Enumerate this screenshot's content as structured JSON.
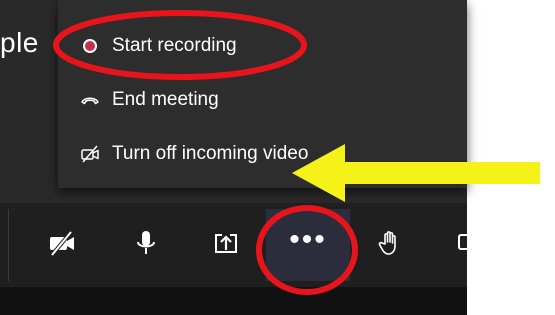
{
  "meeting": {
    "title_partial": "ple"
  },
  "menu": {
    "items": [
      {
        "label": "Start recording",
        "icon": "record-icon"
      },
      {
        "label": "End meeting",
        "icon": "hang-up-icon"
      },
      {
        "label": "Turn off incoming video",
        "icon": "video-off-icon"
      }
    ]
  },
  "toolbar": {
    "buttons": [
      {
        "name": "camera-off",
        "icon": "camera-off-icon"
      },
      {
        "name": "microphone",
        "icon": "microphone-icon"
      },
      {
        "name": "share",
        "icon": "share-tray-icon"
      },
      {
        "name": "more-actions",
        "label": "•••",
        "icon": "more-icon"
      },
      {
        "name": "raise-hand",
        "icon": "raise-hand-icon"
      }
    ]
  },
  "annotations": {
    "circle_color": "#e8141c",
    "arrow_color": "#f5f21a"
  },
  "colors": {
    "record_red": "#c4314b",
    "menu_bg": "#2d2d2d",
    "toolbar_bg": "#1f1f1f",
    "active_button_bg": "#2b2d3c"
  }
}
